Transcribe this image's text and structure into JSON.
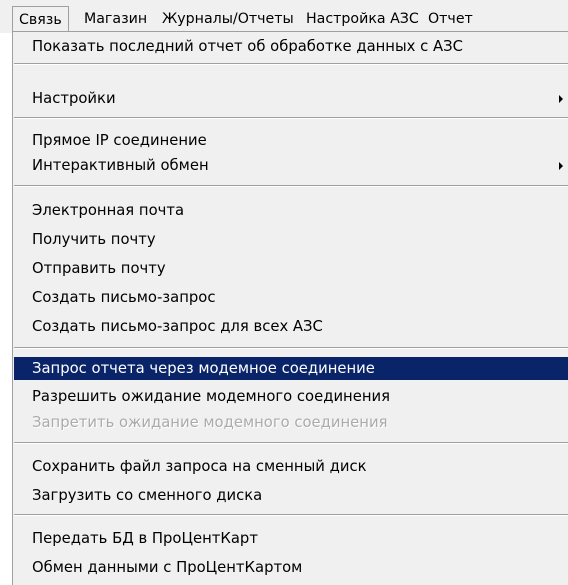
{
  "menubar": {
    "items": [
      {
        "label": "Связь"
      },
      {
        "label": "Магазин"
      },
      {
        "label": "Журналы/Отчеты"
      },
      {
        "label": "Настройка АЗС"
      },
      {
        "label": "Отчет"
      }
    ]
  },
  "menu": {
    "items": [
      {
        "label": "Показать последний отчет об обработке данных с АЗС"
      },
      {
        "label": "Настройки"
      },
      {
        "label": "Прямое IP соединение"
      },
      {
        "label": "Интерактивный обмен"
      },
      {
        "label": "Электронная почта"
      },
      {
        "label": "Получить почту"
      },
      {
        "label": "Отправить почту"
      },
      {
        "label": "Создать письмо-запрос"
      },
      {
        "label": "Создать письмо-запрос для всех АЗС"
      },
      {
        "label": "Запрос отчета через модемное соединение"
      },
      {
        "label": "Разрешить ожидание модемного соединения"
      },
      {
        "label": "Запретить ожидание модемного соединения"
      },
      {
        "label": "Сохранить файл запроса на сменный диск"
      },
      {
        "label": "Загрузить со сменного диска"
      },
      {
        "label": "Передать БД в ПроЦентКарт"
      },
      {
        "label": "Обмен данными с ПроЦентКартом"
      }
    ]
  },
  "colors": {
    "menu_background": "#f0f0f0",
    "highlight_background": "#0a246a",
    "highlight_text": "#ffffff",
    "disabled_text": "#ababab"
  }
}
